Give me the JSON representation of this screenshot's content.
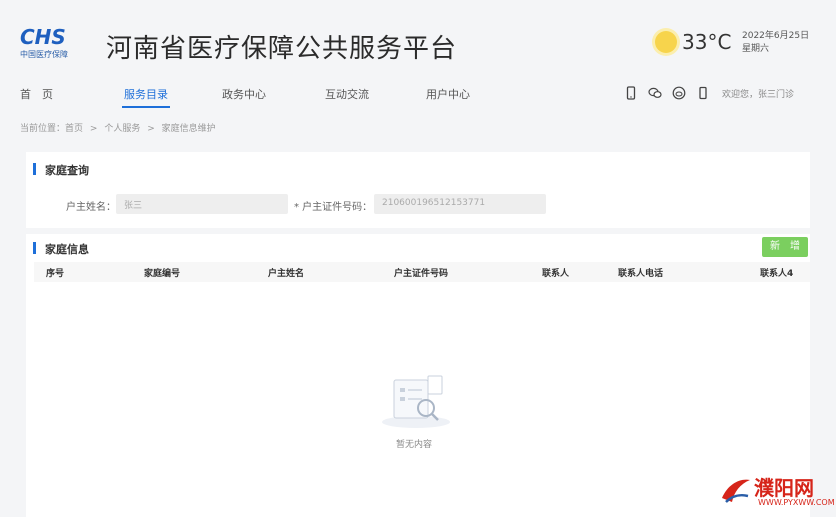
{
  "header": {
    "logo_text": "CHS",
    "logo_subtitle": "中国医疗保障",
    "site_title": "河南省医疗保障公共服务平台",
    "temperature": "33°C",
    "date": "2022年6月25日",
    "weekday": "星期六"
  },
  "nav": {
    "items": [
      "首　页",
      "服务目录",
      "政务中心",
      "互动交流",
      "用户中心"
    ],
    "active_index": 1,
    "icons": [
      "mobile-icon",
      "wechat-icon",
      "weibo-icon",
      "phone-icon"
    ],
    "login_text": "欢迎您，张三门诊"
  },
  "breadcrumb": [
    "当前位置：首页",
    ">",
    "个人服务",
    ">",
    "家庭信息维护"
  ],
  "query": {
    "title": "家庭查询",
    "name_label": "户主姓名：",
    "name_value": "张三",
    "id_label": "* 户主证件号码：",
    "id_value": "210600196512153771"
  },
  "family": {
    "title": "家庭信息",
    "add_button": "新　增",
    "columns": [
      "序号",
      "家庭编号",
      "户主姓名",
      "户主证件号码",
      "联系人",
      "联系人电话",
      "联系人4"
    ],
    "empty_text": "暂无内容"
  },
  "watermark": {
    "name": "濮阳网",
    "url": "WWW.PYXWW.COM"
  },
  "colors": {
    "accent": "#1e6fd9",
    "add_button": "#7bcf5f",
    "watermark": "#d6251a"
  }
}
